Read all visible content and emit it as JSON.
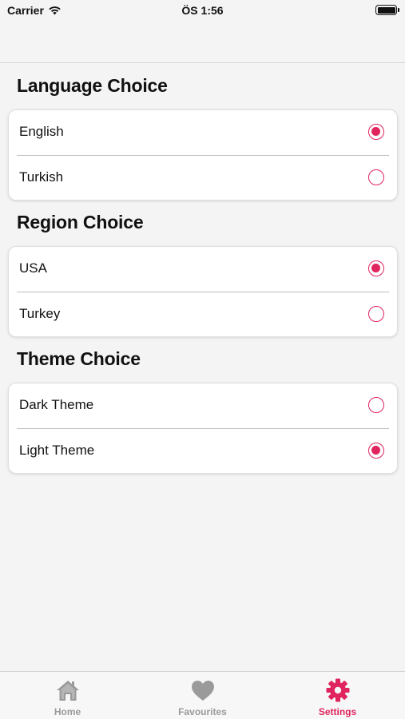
{
  "status_bar": {
    "carrier": "Carrier",
    "time": "ÖS 1:56"
  },
  "sections": [
    {
      "title": "Language Choice",
      "options": [
        {
          "label": "English",
          "selected": true
        },
        {
          "label": "Turkish",
          "selected": false
        }
      ]
    },
    {
      "title": "Region Choice",
      "options": [
        {
          "label": "USA",
          "selected": true
        },
        {
          "label": "Turkey",
          "selected": false
        }
      ]
    },
    {
      "title": "Theme Choice",
      "options": [
        {
          "label": "Dark Theme",
          "selected": false
        },
        {
          "label": "Light Theme",
          "selected": true
        }
      ]
    }
  ],
  "tab_bar": {
    "tabs": [
      {
        "label": "Home",
        "icon": "home-icon",
        "active": false
      },
      {
        "label": "Favourites",
        "icon": "heart-icon",
        "active": false
      },
      {
        "label": "Settings",
        "icon": "gear-icon",
        "active": true
      }
    ]
  },
  "colors": {
    "accent": "#e0245e",
    "inactive": "#9a9a9a",
    "background": "#f4f4f4"
  }
}
